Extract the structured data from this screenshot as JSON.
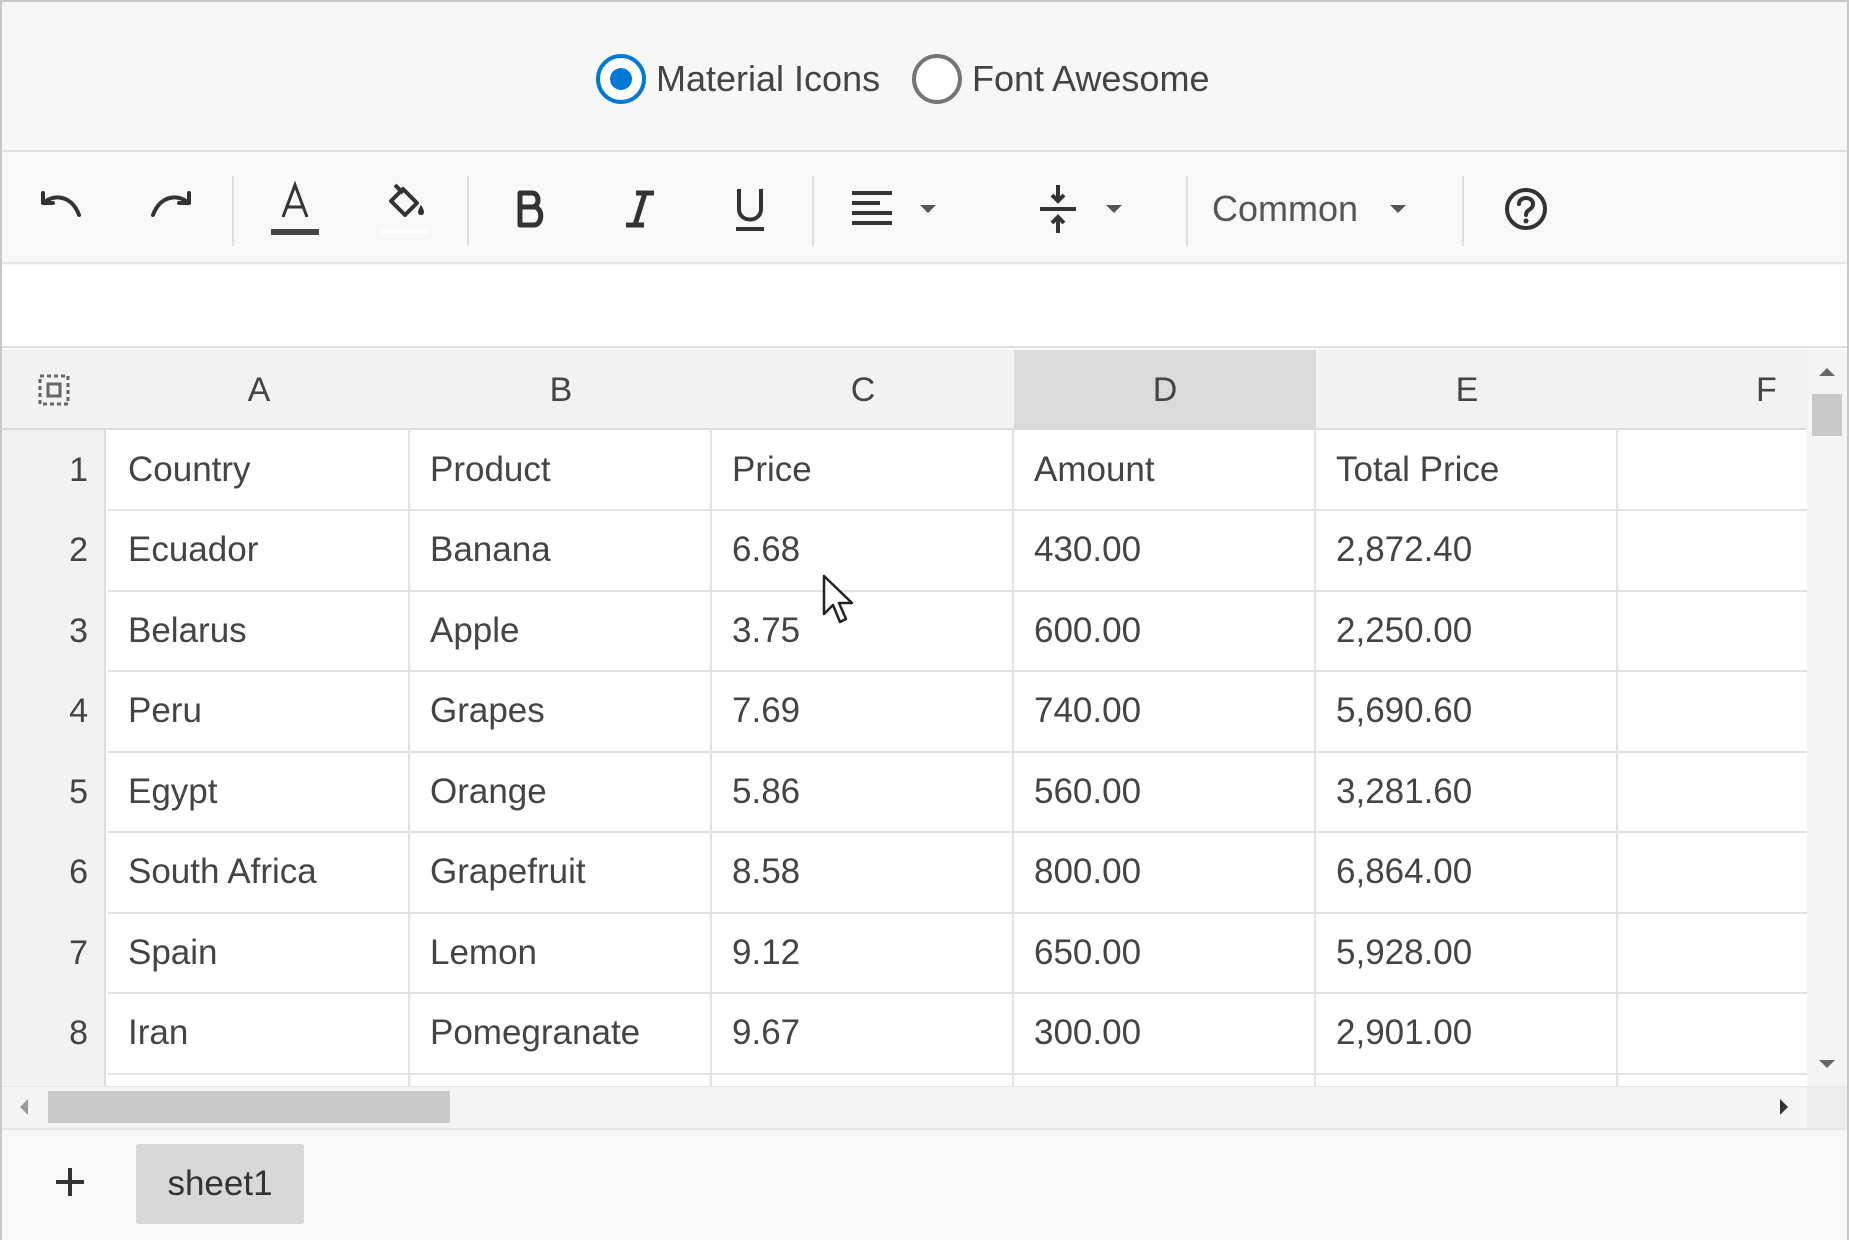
{
  "icon_set_options": [
    {
      "label": "Material Icons",
      "checked": true
    },
    {
      "label": "Font Awesome",
      "checked": false
    }
  ],
  "toolbar": {
    "undo": "undo-icon",
    "redo": "redo-icon",
    "font_color": "font-color-icon",
    "fill_color": "fill-color-icon",
    "bold": "bold-icon",
    "italic": "italic-icon",
    "underline": "underline-icon",
    "align": "align-left-icon",
    "valign": "vertical-align-icon",
    "format_label": "Common",
    "help": "help-icon"
  },
  "accent_color": "#0078d6",
  "grid": {
    "columns": [
      "A",
      "B",
      "C",
      "D",
      "E",
      "F"
    ],
    "selected_column": "D",
    "row_numbers": [
      "1",
      "2",
      "3",
      "4",
      "5",
      "6",
      "7",
      "8"
    ],
    "rows": [
      [
        "Country",
        "Product",
        "Price",
        "Amount",
        "Total Price",
        ""
      ],
      [
        "Ecuador",
        "Banana",
        "6.68",
        "430.00",
        "2,872.40",
        ""
      ],
      [
        "Belarus",
        "Apple",
        "3.75",
        "600.00",
        "2,250.00",
        ""
      ],
      [
        "Peru",
        "Grapes",
        "7.69",
        "740.00",
        "5,690.60",
        ""
      ],
      [
        "Egypt",
        "Orange",
        "5.86",
        "560.00",
        "3,281.60",
        ""
      ],
      [
        "South Africa",
        "Grapefruit",
        "8.58",
        "800.00",
        "6,864.00",
        ""
      ],
      [
        "Spain",
        "Lemon",
        "9.12",
        "650.00",
        "5,928.00",
        ""
      ],
      [
        "Iran",
        "Pomegranate",
        "9.67",
        "300.00",
        "2,901.00",
        ""
      ]
    ]
  },
  "sheets": {
    "add_icon": "plus-icon",
    "tabs": [
      "sheet1"
    ]
  }
}
